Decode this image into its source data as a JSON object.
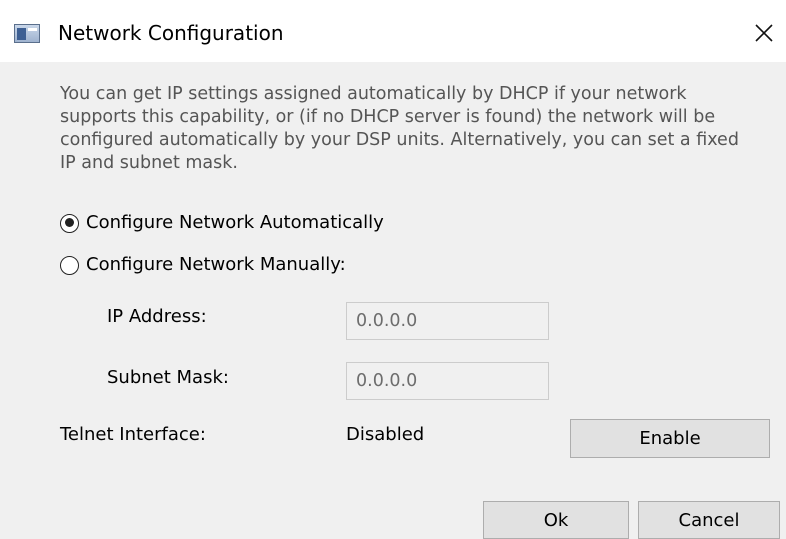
{
  "window": {
    "title": "Network Configuration",
    "icon": "app-window-icon",
    "close_icon": "close-icon"
  },
  "description": "You can get IP settings assigned automatically by DHCP if your network supports this capability, or (if no DHCP server is found) the network will be configured automatically by your DSP units. Alternatively, you can set a fixed IP and subnet mask.",
  "options": {
    "automatic_label": "Configure Network Automatically",
    "manual_label": "Configure Network Manually:",
    "selected": "automatic"
  },
  "ip": {
    "label": "IP Address:",
    "value": "0.0.0.0"
  },
  "subnet": {
    "label": "Subnet Mask:",
    "value": "0.0.0.0"
  },
  "telnet": {
    "label": "Telnet Interface:",
    "status": "Disabled",
    "button_label": "Enable"
  },
  "buttons": {
    "ok_label": "Ok",
    "cancel_label": "Cancel"
  }
}
